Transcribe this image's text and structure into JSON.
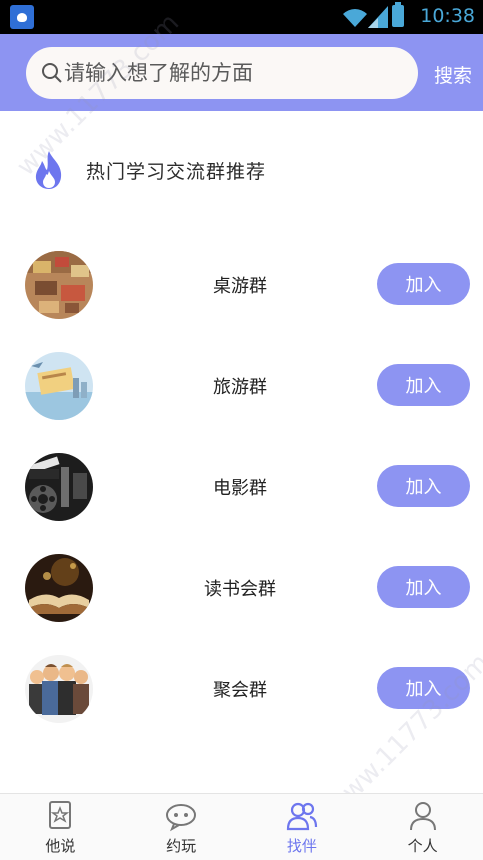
{
  "status_bar": {
    "time": "10:38"
  },
  "search": {
    "placeholder": "请输入想了解的方面",
    "button_label": "搜索"
  },
  "section": {
    "title": "热门学习交流群推荐"
  },
  "groups": [
    {
      "name": "桌游群",
      "join_label": "加入"
    },
    {
      "name": "旅游群",
      "join_label": "加入"
    },
    {
      "name": "电影群",
      "join_label": "加入"
    },
    {
      "name": "读书会群",
      "join_label": "加入"
    },
    {
      "name": "聚会群",
      "join_label": "加入"
    }
  ],
  "bottom_nav": {
    "items": [
      {
        "label": "他说",
        "icon": "star-page-icon",
        "active": false
      },
      {
        "label": "约玩",
        "icon": "chat-face-icon",
        "active": false
      },
      {
        "label": "找伴",
        "icon": "users-icon",
        "active": true
      },
      {
        "label": "个人",
        "icon": "person-icon",
        "active": false
      }
    ]
  },
  "watermark": "www.11773.com",
  "colors": {
    "accent": "#8d94f2",
    "active_nav": "#6d76ee",
    "flame": "#6d76ee"
  }
}
